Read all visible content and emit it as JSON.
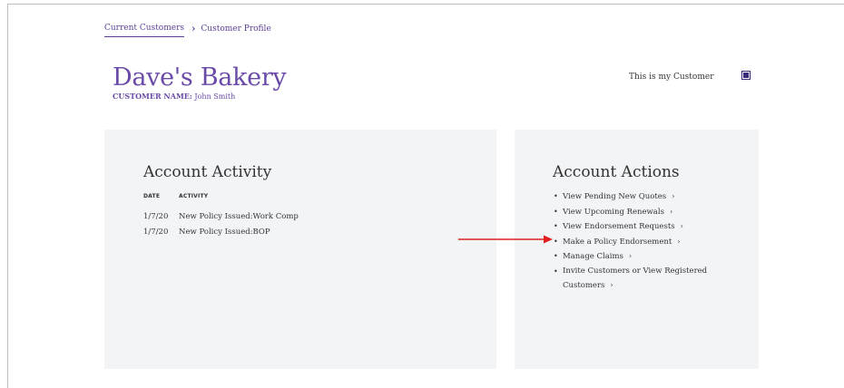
{
  "breadcrumb": {
    "link": "Current Customers",
    "separator": "›",
    "current": "Customer Profile"
  },
  "customer": {
    "business_name": "Dave's Bakery",
    "name_label": "CUSTOMER NAME:",
    "name_value": " John Smith"
  },
  "my_customer": {
    "label": "This is my Customer",
    "checked": true
  },
  "activity": {
    "title": "Account Activity",
    "columns": [
      "DATE",
      "ACTIVITY"
    ],
    "rows": [
      {
        "date": "1/7/20",
        "activity": "New Policy Issued:Work Comp"
      },
      {
        "date": "1/7/20",
        "activity": "New Policy Issued:BOP"
      }
    ]
  },
  "actions": {
    "title": "Account Actions",
    "items": [
      {
        "label": "View Pending New Quotes",
        "chevron": "›"
      },
      {
        "label": "View Upcoming Renewals",
        "chevron": "›"
      },
      {
        "label": "View Endorsement Requests",
        "chevron": "›"
      },
      {
        "label": "Make a Policy Endorsement",
        "chevron": "›"
      },
      {
        "label": "Manage Claims",
        "chevron": "›"
      },
      {
        "label": "Invite Customers or View Registered Customers",
        "chevron": "›"
      }
    ]
  },
  "colors": {
    "brand_purple": "#6a4aa8",
    "link_purple": "#5b3f97",
    "panel_bg": "#f3f4f6",
    "annotation_arrow": "#e02020"
  }
}
